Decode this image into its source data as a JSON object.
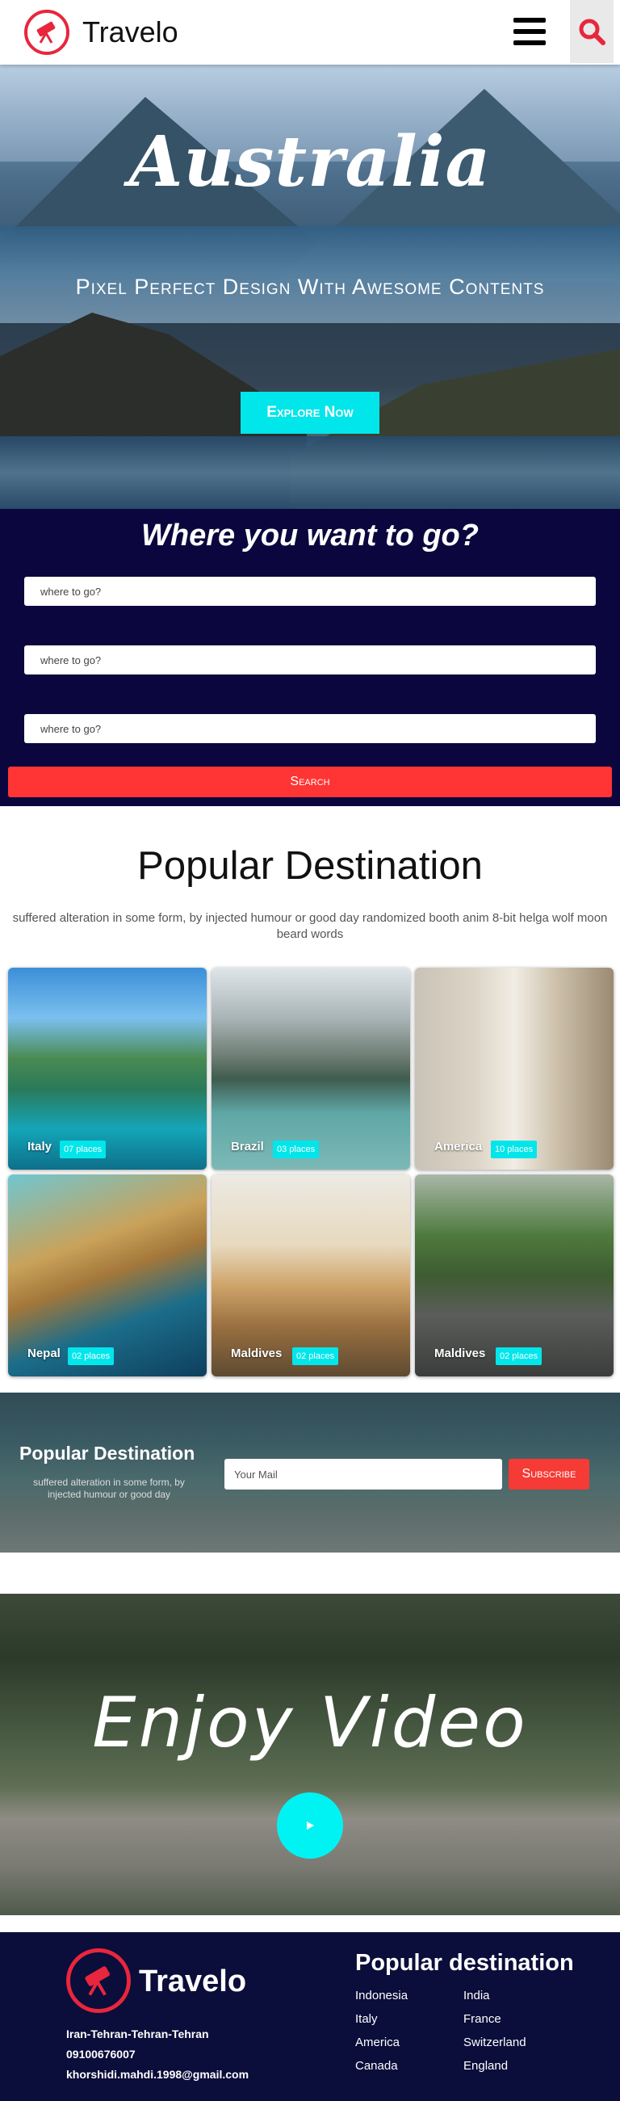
{
  "header": {
    "brand": "Travelo",
    "menu_icon": "hamburger-icon",
    "search_icon": "search-icon"
  },
  "hero": {
    "title": "Australia",
    "subtitle": "Pixel Perfect Design With Awesome Contents",
    "cta": "Explore Now"
  },
  "search": {
    "title": "Where you want to go?",
    "fields": [
      {
        "placeholder": "where to go?"
      },
      {
        "placeholder": "where to go?"
      },
      {
        "placeholder": "where to go?"
      }
    ],
    "button": "Search"
  },
  "popular": {
    "title": "Popular Destination",
    "description": "suffered alteration in some form, by injected humour or good day randomized booth anim 8-bit helga wolf moon beard words",
    "cards": [
      {
        "name": "Italy",
        "badge": "07 places"
      },
      {
        "name": "Brazil",
        "badge": "03 places"
      },
      {
        "name": "America",
        "badge": "10 places"
      },
      {
        "name": "Nepal",
        "badge": "02 places"
      },
      {
        "name": "Maldives",
        "badge": "02 places"
      },
      {
        "name": "Maldives",
        "badge": "02 places"
      }
    ]
  },
  "subscribe": {
    "title": "Popular Destination",
    "description": "suffered alteration in some form, by injected humour or good day",
    "placeholder": "Your Mail",
    "button": "Subscribe"
  },
  "video": {
    "title": "Enjoy Video",
    "play_icon": "play-icon"
  },
  "footer": {
    "brand": "Travelo",
    "address": "Iran-Tehran-Tehran-Tehran",
    "phone": "09100676007",
    "email": "khorshidi.mahdi.1998@gmail.com",
    "heading": "Popular destination",
    "links": [
      "Indonesia",
      "India",
      "Italy",
      "France",
      "America",
      "Switzerland",
      "Canada",
      "England"
    ]
  },
  "colors": {
    "accent": "#e8263d",
    "cyan": "#00e6ea",
    "navy": "#0b073e",
    "red_button": "#ff3434"
  }
}
